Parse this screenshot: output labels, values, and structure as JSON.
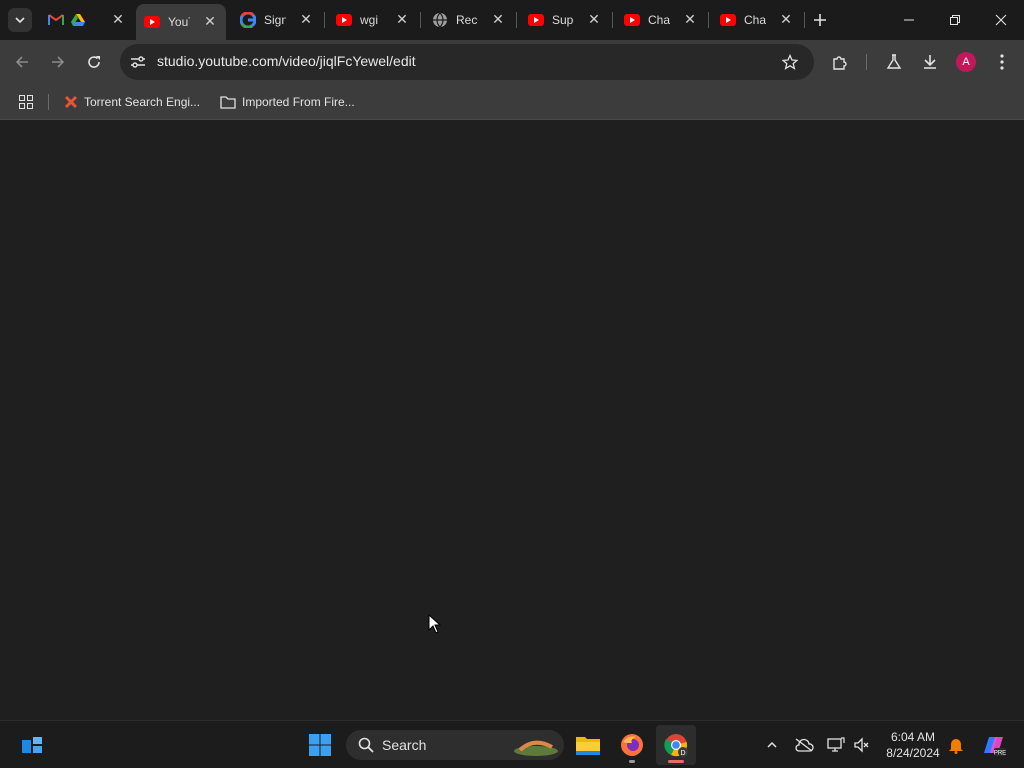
{
  "tabs": [
    {
      "title": "",
      "favicon": "gmail-drive-icon",
      "active": false
    },
    {
      "title": "YouTube",
      "favicon": "youtube-icon",
      "active": true
    },
    {
      "title": "Sign in",
      "favicon": "google-icon",
      "active": false
    },
    {
      "title": "wgi",
      "favicon": "youtube-icon",
      "active": false
    },
    {
      "title": "Recent",
      "favicon": "globe-icon",
      "active": false
    },
    {
      "title": "Super",
      "favicon": "youtube-icon",
      "active": false
    },
    {
      "title": "Channel",
      "favicon": "youtube-icon",
      "active": false
    },
    {
      "title": "Channel",
      "favicon": "youtube-icon",
      "active": false
    }
  ],
  "toolbar": {
    "url": "studio.youtube.com/video/jiqlFcYewel/edit"
  },
  "bookmarks": [
    {
      "label": "Torrent Search Engi...",
      "icon": "x-favicon-icon"
    },
    {
      "label": "Imported From Fire...",
      "icon": "folder-icon"
    }
  ],
  "taskbar": {
    "search_label": "Search",
    "time": "6:04 AM",
    "date": "8/24/2024"
  },
  "colors": {
    "youtube_red": "#ff0000",
    "avatar": "#c2185b",
    "page_bg": "#1f1f1f",
    "toolbar_bg": "#3c3c3c"
  },
  "profile": {
    "initial": "A"
  }
}
